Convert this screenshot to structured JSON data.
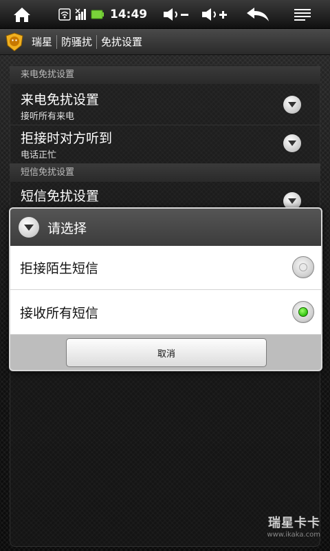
{
  "status_bar": {
    "time": "14:49",
    "icons": [
      "home-icon",
      "wifi-icon",
      "signal-icon",
      "battery-icon",
      "volume-down-icon",
      "volume-up-icon",
      "back-icon",
      "menu-icon"
    ],
    "battery_color": "#7ad43a"
  },
  "title_bar": {
    "app_name": "瑞星",
    "crumbs": [
      "防骚扰",
      "免扰设置"
    ]
  },
  "settings": {
    "section_calls": "来电免扰设置",
    "call_pref_title": "来电免扰设置",
    "call_pref_summary": "接听所有来电",
    "reject_pref_title": "拒接时对方听到",
    "reject_pref_summary": "电话正忙",
    "section_sms": "短信免扰设置",
    "sms_pref_title": "短信免扰设置"
  },
  "dialog": {
    "title": "请选择",
    "options": [
      {
        "label": "拒接陌生短信",
        "selected": false
      },
      {
        "label": "接收所有短信",
        "selected": true
      }
    ],
    "cancel_label": "取消"
  },
  "watermark": {
    "main": "瑞星卡卡",
    "sub": "www.ikaka.com"
  },
  "colors": {
    "accent_green": "#2fc20f",
    "dialog_bg": "#ffffff"
  }
}
